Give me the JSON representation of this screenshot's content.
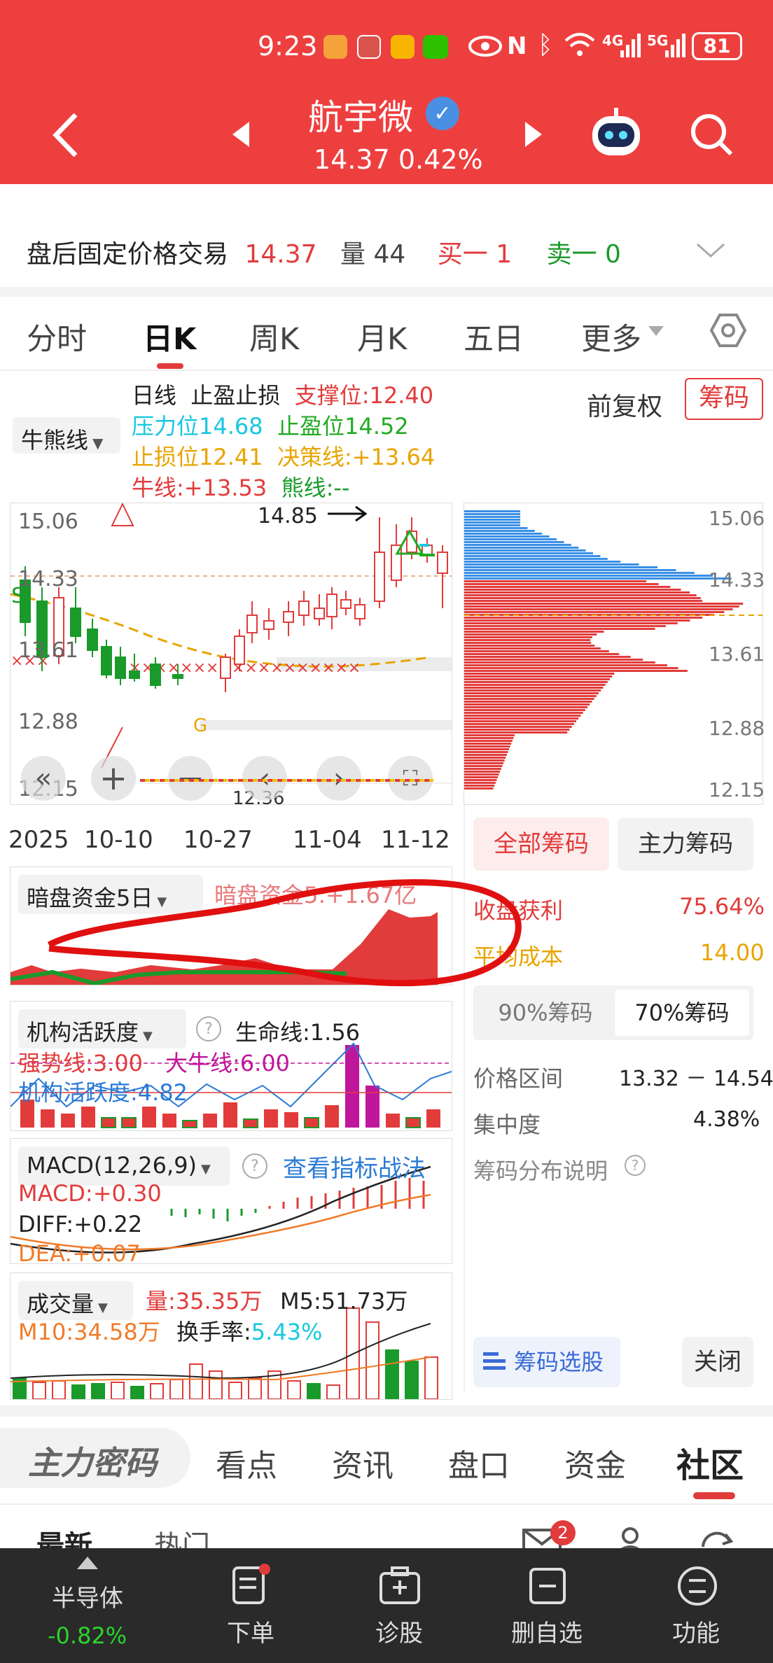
{
  "status": {
    "time": "9:23",
    "network": "4G",
    "network2": "5G",
    "battery": "81"
  },
  "header": {
    "stock_name": "航宇微",
    "price": "14.37",
    "change": "0.42%"
  },
  "after_hours": {
    "label": "盘后固定价格交易",
    "price": "14.37",
    "vol_label": "量",
    "vol": "44",
    "buy_label": "买一",
    "buy": "1",
    "sell_label": "卖一",
    "sell": "0"
  },
  "chart_tabs": [
    "分时",
    "日K",
    "周K",
    "月K",
    "五日",
    "更多"
  ],
  "indicator": {
    "dropdown": "牛熊线",
    "line1": "日线",
    "line1b": "止盈止损",
    "support": "支撑位:12.40",
    "pressure": "压力位14.68",
    "takeprofit": "止盈位14.52",
    "stoploss": "止损位12.41",
    "decision": "决策线:+13.64",
    "bull": "牛线:+13.53",
    "bear": "熊线:--",
    "fuquan": "前复权",
    "chouma": "筹码"
  },
  "kline": {
    "y_ticks": [
      "15.06",
      "14.33",
      "13.61",
      "12.88",
      "12.15"
    ],
    "high_label": "14.85",
    "low_label": "12.36",
    "s_marker": "S",
    "g_marker": "G",
    "x_ticks": [
      "2025",
      "10-10",
      "10-27",
      "11-04",
      "11-12"
    ]
  },
  "chips": {
    "y_ticks": [
      "15.06",
      "14.33",
      "13.61",
      "12.88",
      "12.15"
    ],
    "tab_all": "全部筹码",
    "tab_main": "主力筹码",
    "profit_label": "收盘获利",
    "profit": "75.64%",
    "cost_label": "平均成本",
    "cost": "14.00",
    "pct90": "90%筹码",
    "pct70": "70%筹码",
    "range_label": "价格区间",
    "range": "13.32 － 14.54",
    "conc_label": "集中度",
    "conc": "4.38%",
    "explain": "筹码分布说明",
    "select_btn": "筹码选股",
    "close_btn": "关闭"
  },
  "dark_pool": {
    "dropdown": "暗盘资金5日",
    "value": "暗盘资金5:+1.67亿"
  },
  "inst": {
    "dropdown": "机构活跃度",
    "life": "生命线:1.56",
    "strong": "强势线:3.00",
    "bigbull": "大牛线:6.00",
    "activity": "机构活跃度:4.82"
  },
  "macd": {
    "dropdown": "MACD(12,26,9)",
    "link": "查看指标战法",
    "macd": "MACD:+0.30",
    "diff": "DIFF:+0.22",
    "dea": "DEA:+0.07"
  },
  "volume": {
    "dropdown": "成交量",
    "vol": "量:35.35万",
    "m5": "M5:51.73万",
    "m10": "M10:34.58万",
    "turnover_label": "换手率:",
    "turnover": "5.43%"
  },
  "bottom_tabs": [
    "主力密码",
    "看点",
    "资讯",
    "盘口",
    "资金",
    "社区"
  ],
  "sub_tabs": [
    "最新",
    "热门"
  ],
  "mail_badge": "2",
  "nav": {
    "sector": "半导体",
    "sector_change": "-0.82%",
    "items": [
      "下单",
      "诊股",
      "删自选",
      "功能"
    ]
  },
  "colors": {
    "brand": "#ee3f3f",
    "up": "#e23b3b",
    "down": "#1a9a2a",
    "chip_blue": "#3a8fe6"
  }
}
